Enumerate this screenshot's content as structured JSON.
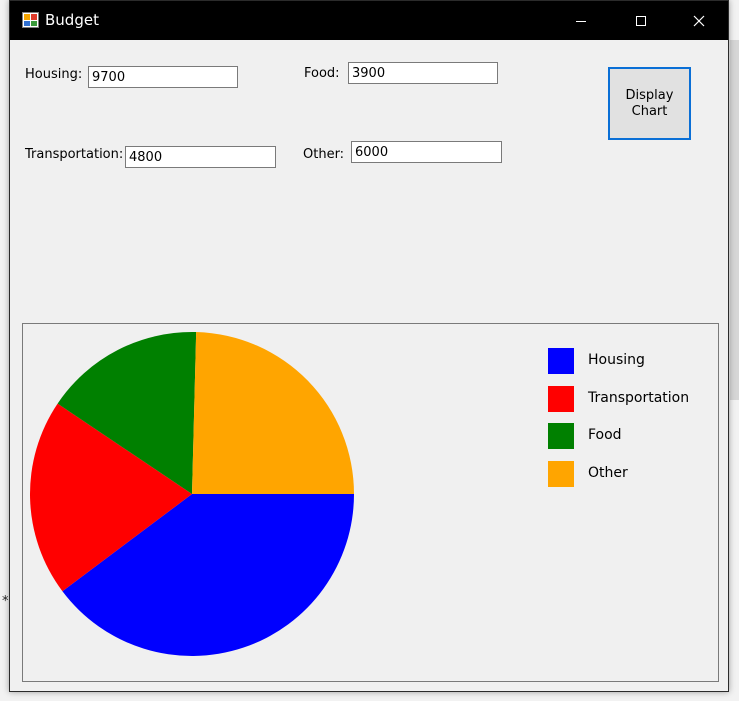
{
  "window": {
    "title": "Budget"
  },
  "titlebar_controls": {
    "minimize": "—",
    "maximize": "☐",
    "close": "✕"
  },
  "form": {
    "housing": {
      "label": "Housing:",
      "value": "9700"
    },
    "food": {
      "label": "Food:",
      "value": "3900"
    },
    "transportation": {
      "label": "Transportation:",
      "value": "4800"
    },
    "other": {
      "label": "Other:",
      "value": "6000"
    },
    "display_button": {
      "line1": "Display",
      "line2": "Chart"
    }
  },
  "background_fragment": {
    "asterisk": "*"
  },
  "chart_data": {
    "type": "pie",
    "categories": [
      "Housing",
      "Transportation",
      "Food",
      "Other"
    ],
    "values": [
      9700,
      4800,
      3900,
      6000
    ],
    "colors": [
      "#0000ff",
      "#ff0000",
      "#008000",
      "#ffa500"
    ],
    "legend_position": "right"
  }
}
